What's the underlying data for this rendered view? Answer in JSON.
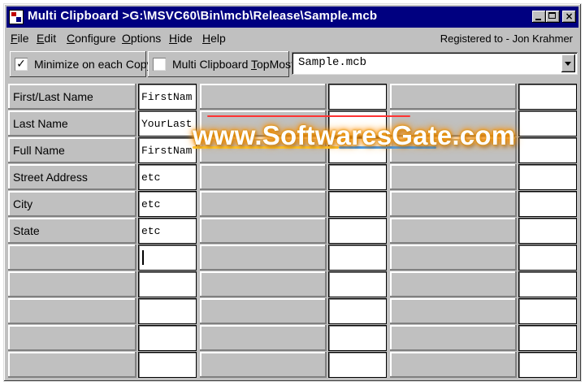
{
  "window": {
    "title": "Multi Clipboard >G:\\MSVC60\\Bin\\mcb\\Release\\Sample.mcb",
    "buttons": {
      "minimize": "minimize",
      "maximize": "maximize",
      "close": "×"
    }
  },
  "menu": {
    "items": [
      {
        "accel": "F",
        "rest": "ile"
      },
      {
        "accel": "E",
        "rest": "dit"
      },
      {
        "accel": "C",
        "rest": "onfigure"
      },
      {
        "accel": "O",
        "rest": "ptions"
      },
      {
        "accel": "H",
        "rest": "ide"
      },
      {
        "accel": "H",
        "rest": "elp"
      }
    ],
    "registered": "Registered to - Jon Krahmer"
  },
  "toolbar": {
    "minimize_check": {
      "label": "Minimize on each Copy",
      "checked": true,
      "mark": "✓"
    },
    "topmost_check": {
      "label_pre": "Multi Clipboard ",
      "label_accel": "T",
      "label_post": "opMost",
      "checked": false,
      "mark": ""
    },
    "file_combo": {
      "value": "Sample.mcb"
    }
  },
  "grid": {
    "rows": [
      {
        "label": "First/Last Name",
        "value": "FirstNam"
      },
      {
        "label": "Last Name",
        "value": "YourLast"
      },
      {
        "label": "Full Name",
        "value": "FirstNam"
      },
      {
        "label": "Street Address",
        "value": "etc"
      },
      {
        "label": "City",
        "value": "etc"
      },
      {
        "label": "State",
        "value": "etc"
      },
      {
        "label": "",
        "value": ""
      },
      {
        "label": "",
        "value": ""
      },
      {
        "label": "",
        "value": ""
      },
      {
        "label": "",
        "value": ""
      },
      {
        "label": "",
        "value": ""
      }
    ]
  },
  "watermark": {
    "text": "www.SoftwaresGate.com"
  },
  "colors": {
    "title_bar": "#000080",
    "face": "#c0c0c0",
    "watermark_glow": "#ff9900"
  }
}
